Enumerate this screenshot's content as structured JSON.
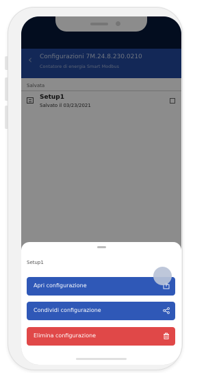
{
  "header": {
    "title": "Configurazioni 7M.24.8.230.0210",
    "subtitle": "Contatore di energia Smart Modbus"
  },
  "saved_section": {
    "label": "Salvata",
    "items": [
      {
        "name": "Setup1",
        "date_text": "Salvato il 03/23/2021"
      }
    ]
  },
  "sheet": {
    "title": "Setup1",
    "actions": [
      {
        "label": "Apri configurazione",
        "icon": "export-icon",
        "color": "#2f58b7"
      },
      {
        "label": "Condividi configurazione",
        "icon": "share-icon",
        "color": "#2f58b7"
      },
      {
        "label": "Elimina configurazione",
        "icon": "trash-icon",
        "color": "#e04848"
      }
    ]
  },
  "colors": {
    "header_bg": "#244a9e",
    "status_bg": "#061839",
    "primary": "#2f58b7",
    "danger": "#e04848"
  }
}
